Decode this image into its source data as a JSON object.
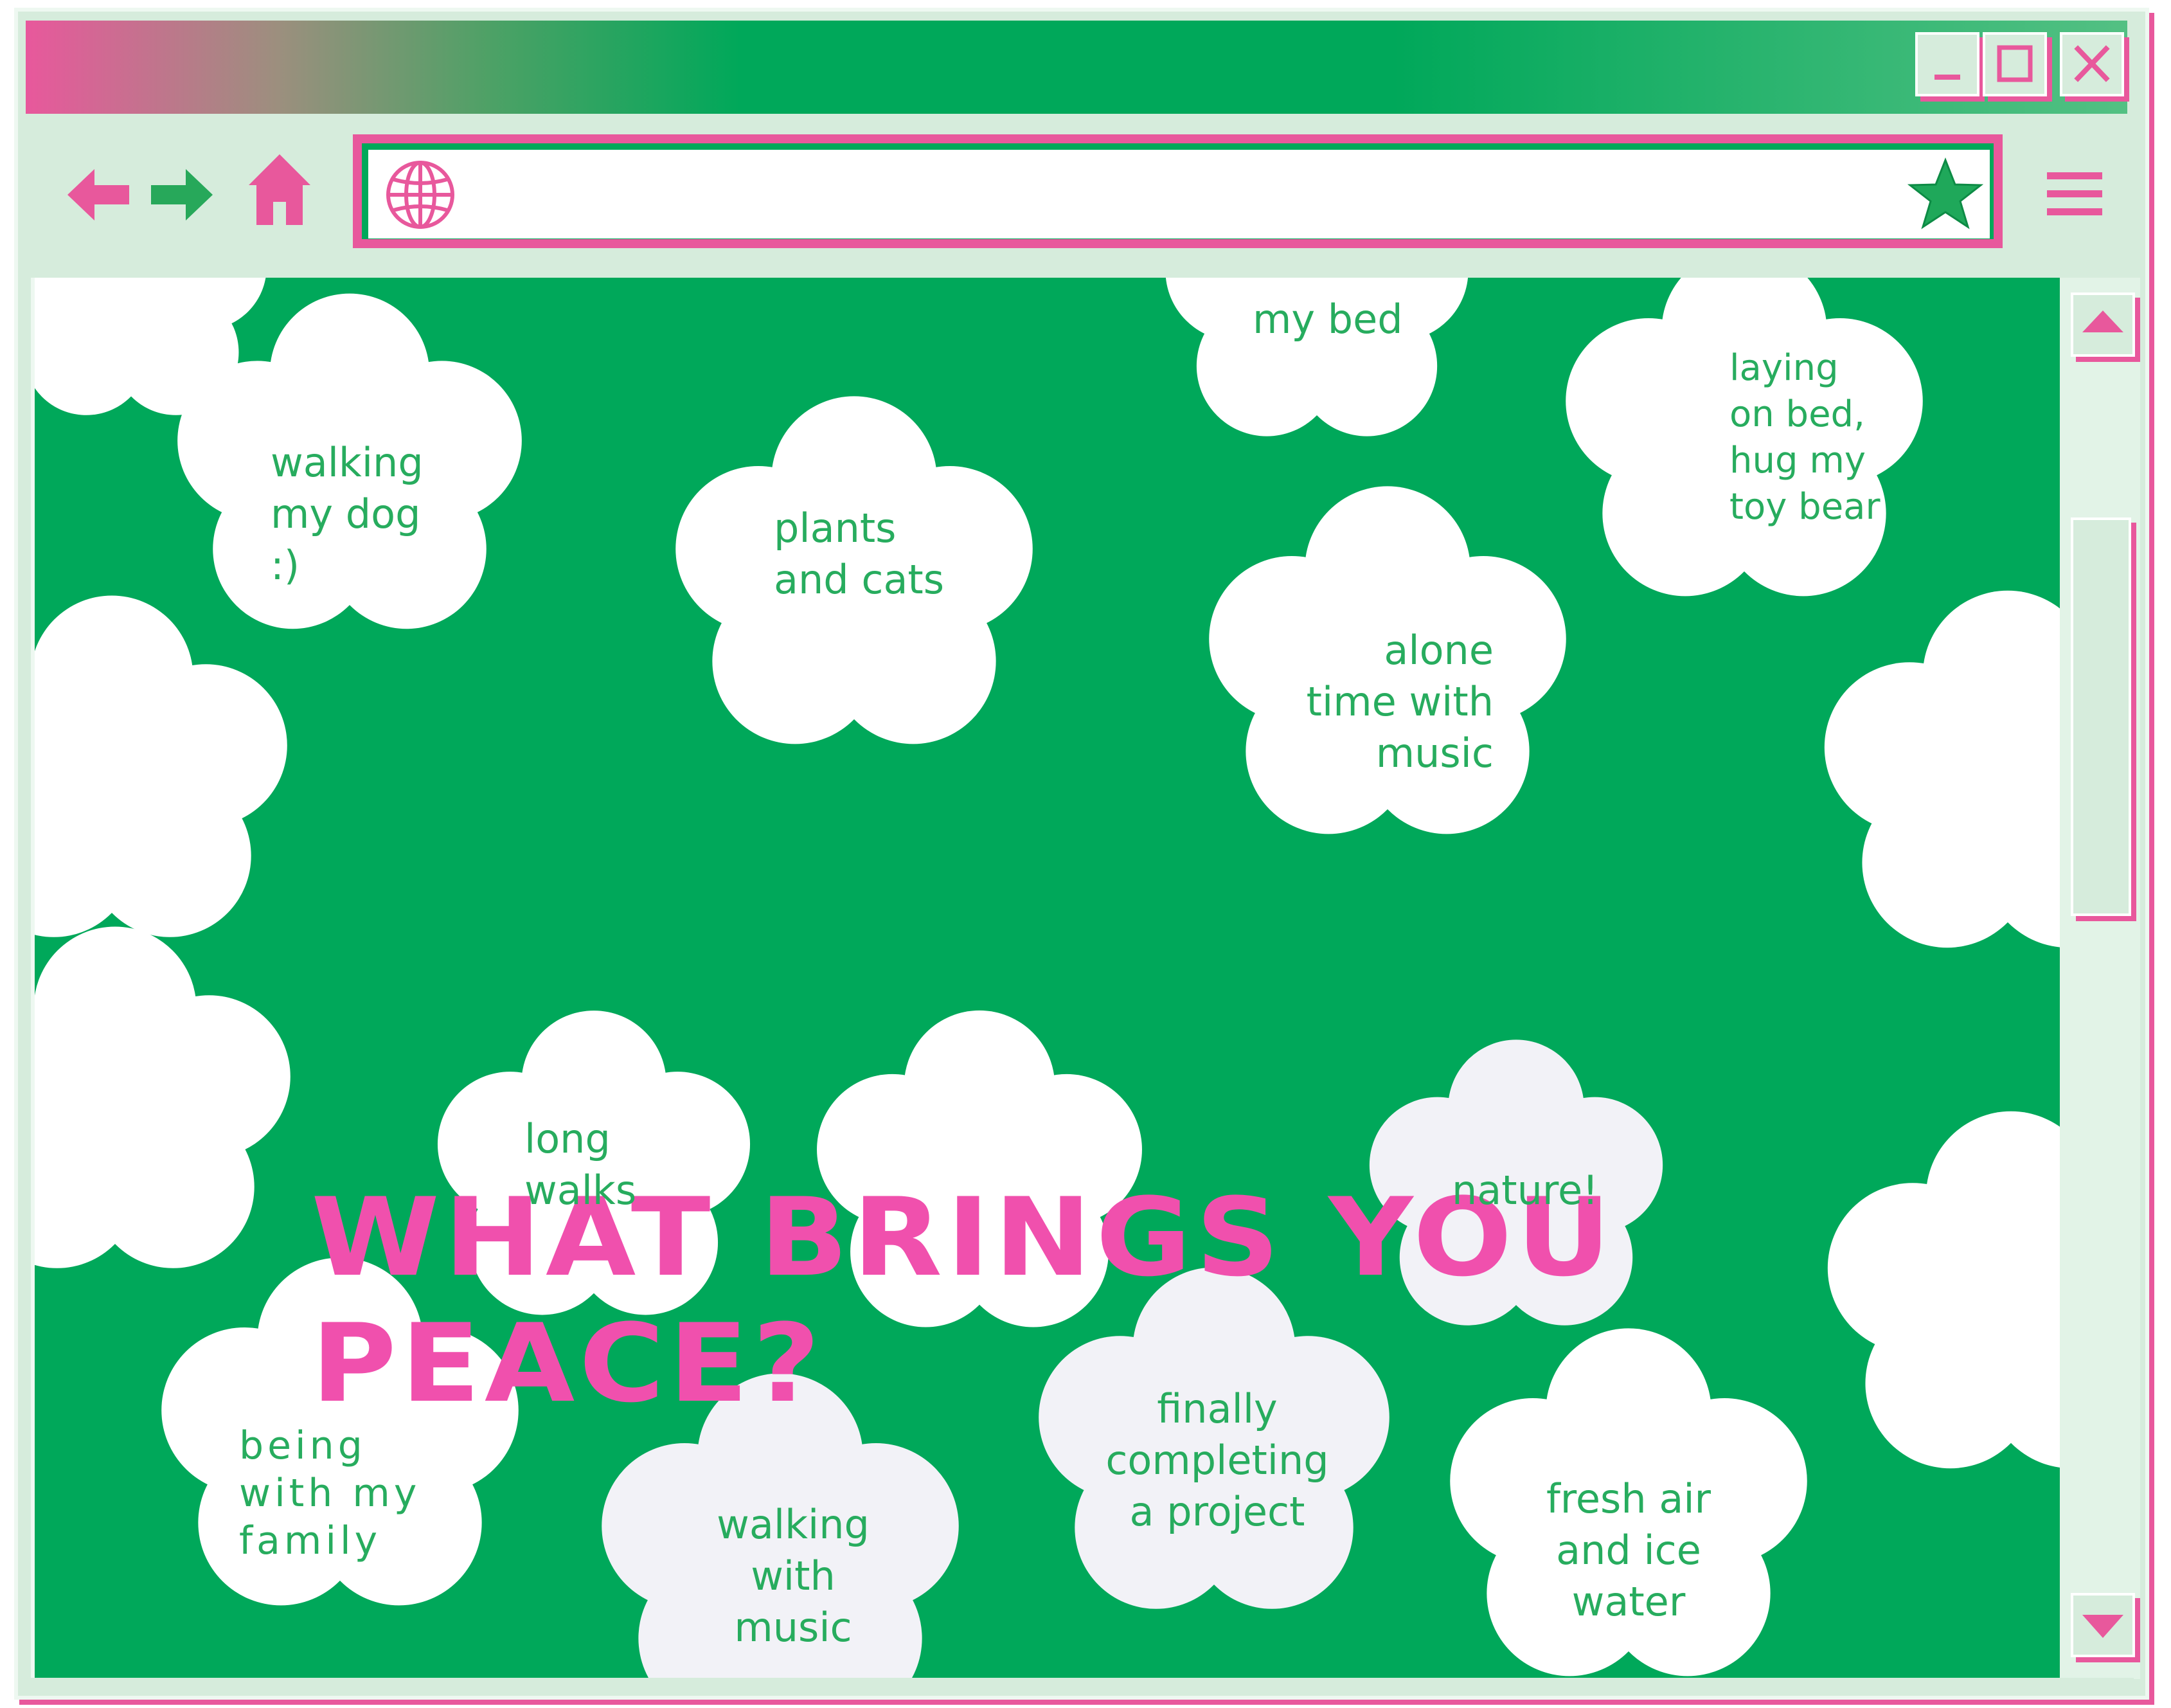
{
  "window": {
    "controls": {
      "minimize": "_",
      "maximize": "□",
      "close": "×"
    }
  },
  "toolbar": {
    "back_icon": "arrow-left-icon",
    "forward_icon": "arrow-right-icon",
    "home_icon": "home-icon",
    "globe_icon": "globe-icon",
    "bookmark_icon": "star-icon",
    "menu_icon": "hamburger-menu-icon",
    "address_value": ""
  },
  "page": {
    "headline": "WHAT BRINGS YOU PEACE?",
    "notes": [
      "walking\nmy dog\n:)",
      "plants\nand cats",
      "my bed",
      "laying\non bed,\nhug my\ntoy bear",
      "alone\ntime with\nmusic",
      "long\nwalks",
      "nature!",
      "being\nwith my\nfamily",
      "walking\nwith\nmusic",
      "finally\ncompleting\na project",
      "fresh air\nand ice\nwater"
    ]
  },
  "colors": {
    "accent_pink": "#e8589c",
    "headline_pink": "#f050ad",
    "brand_green": "#00a85a",
    "frame_mint": "#d6ecdc",
    "note_text_green": "#27ac5e",
    "cloud_white": "#ffffff",
    "cloud_lavender": "#f2f2f7"
  }
}
